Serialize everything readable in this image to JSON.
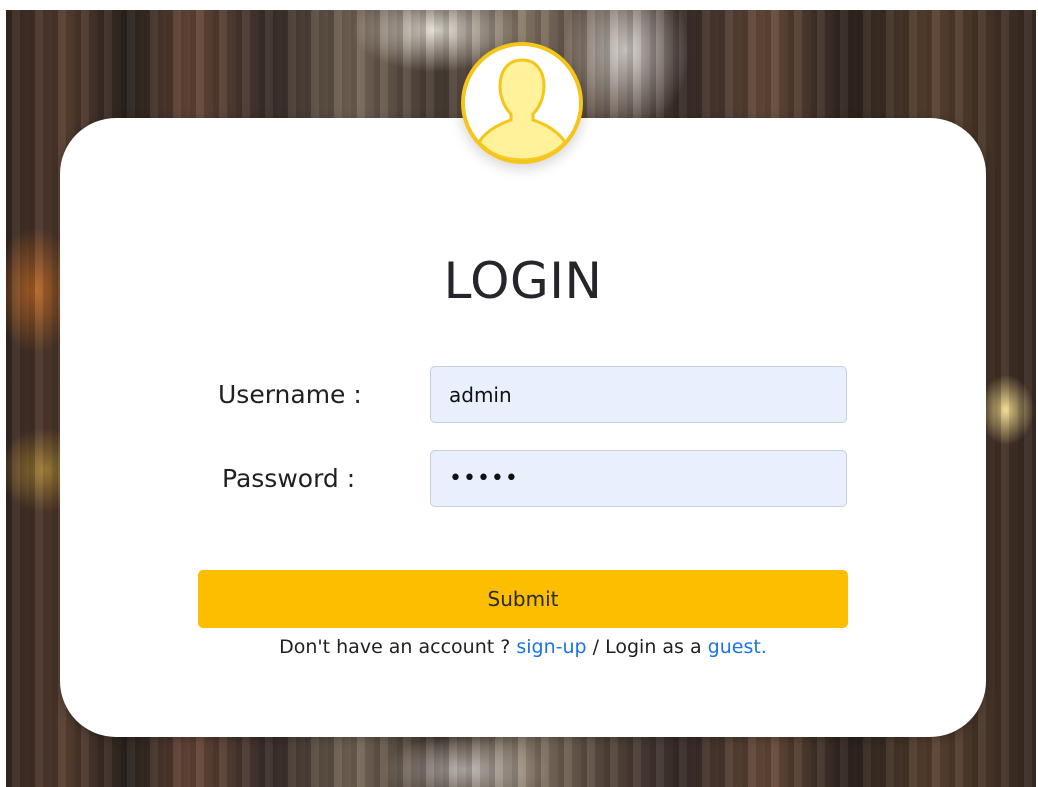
{
  "login": {
    "title": "LOGIN",
    "username_label": "Username :",
    "username_value": "admin",
    "password_label": "Password :",
    "password_value": "admin",
    "submit_label": "Submit",
    "footer_prefix": "Don't have an account ? ",
    "signup_link": "sign-up",
    "footer_middle": " / Login as a ",
    "guest_link": "guest."
  },
  "colors": {
    "accent": "#fdbe00",
    "avatar_ring": "#f5c518",
    "link": "#1a73e8",
    "input_bg": "#e8f0fe"
  },
  "icons": {
    "avatar": "user-silhouette-icon"
  }
}
